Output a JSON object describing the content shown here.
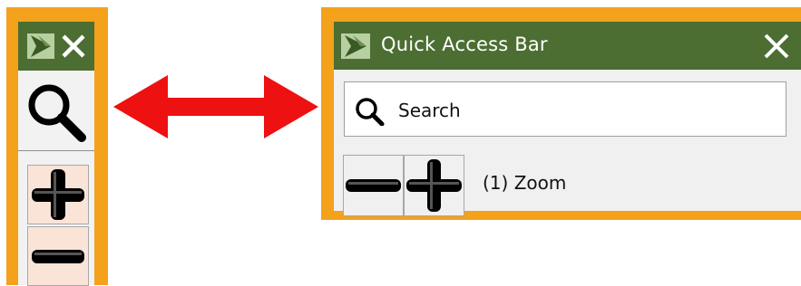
{
  "collapsed_bar": {
    "icons": {
      "logo": "play-logo-icon",
      "close": "close-icon",
      "search": "search-icon",
      "zoom_in": "plus-icon",
      "zoom_out": "minus-icon"
    }
  },
  "arrow": {
    "icon": "double-headed-arrow",
    "color": "#ee1111"
  },
  "expanded_bar": {
    "title": "Quick Access Bar",
    "search": {
      "placeholder": "Search"
    },
    "zoom_label": "(1) Zoom"
  },
  "colors": {
    "frame_orange": "#f4a11c",
    "header_green": "#4c6e32",
    "zoom_button_bg": "#fae4d7",
    "arrow_red": "#ee1111"
  }
}
